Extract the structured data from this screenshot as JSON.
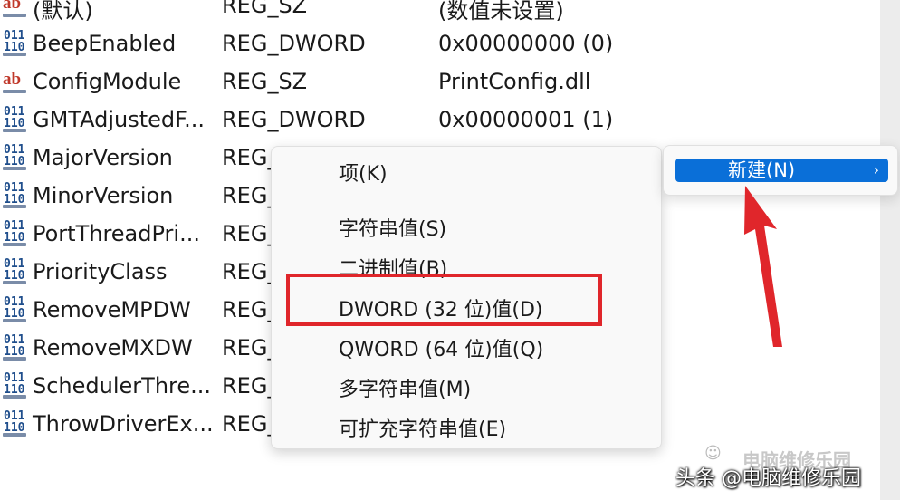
{
  "values": [
    {
      "name": "(默认)",
      "type": "REG_SZ",
      "data": "(数值未设置)",
      "icon": "string-value-icon"
    },
    {
      "name": "BeepEnabled",
      "type": "REG_DWORD",
      "data": "0x00000000 (0)",
      "icon": "binary-value-icon"
    },
    {
      "name": "ConfigModule",
      "type": "REG_SZ",
      "data": "PrintConfig.dll",
      "icon": "string-value-icon"
    },
    {
      "name": "GMTAdjustedF...",
      "type": "REG_DWORD",
      "data": "0x00000001 (1)",
      "icon": "binary-value-icon"
    },
    {
      "name": "MajorVersion",
      "type": "REG_",
      "data": "",
      "icon": "binary-value-icon"
    },
    {
      "name": "MinorVersion",
      "type": "REG_",
      "data": "",
      "icon": "binary-value-icon"
    },
    {
      "name": "PortThreadPri...",
      "type": "REG_",
      "data": "",
      "icon": "binary-value-icon"
    },
    {
      "name": "PriorityClass",
      "type": "REG_",
      "data": "",
      "icon": "binary-value-icon"
    },
    {
      "name": "RemoveMPDW",
      "type": "REG_",
      "data": "",
      "icon": "binary-value-icon"
    },
    {
      "name": "RemoveMXDW",
      "type": "REG_",
      "data": "",
      "icon": "binary-value-icon"
    },
    {
      "name": "SchedulerThre...",
      "type": "REG_",
      "data": "",
      "icon": "binary-value-icon"
    },
    {
      "name": "ThrowDriverEx...",
      "type": "REG_",
      "data": "",
      "icon": "binary-value-icon"
    }
  ],
  "context_menu": {
    "items": [
      {
        "label": "项(K)"
      },
      {
        "label": "字符串值(S)"
      },
      {
        "label": "二进制值(B)"
      },
      {
        "label": "DWORD (32 位)值(D)"
      },
      {
        "label": "QWORD (64 位)值(Q)"
      },
      {
        "label": "多字符串值(M)"
      },
      {
        "label": "可扩充字符串值(E)"
      }
    ]
  },
  "submenu": {
    "label": "新建(N)",
    "chevron": "›"
  },
  "icon_glyphs": {
    "string": "ab",
    "binary_top": "011",
    "binary_bottom": "110"
  },
  "watermark": {
    "faint": "电脑维修乐园",
    "main": "头条 @电脑维修乐园"
  },
  "colors": {
    "highlight": "#0a6fd8",
    "annotation_red": "#e0262b",
    "menu_bg": "#f9f9f9"
  }
}
